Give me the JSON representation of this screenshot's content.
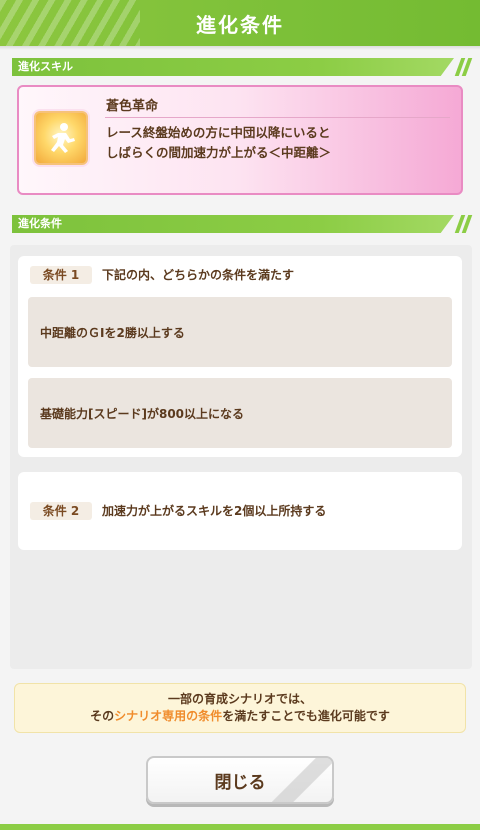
{
  "header": {
    "title": "進化条件"
  },
  "skill_section": {
    "label": "進化スキル"
  },
  "skill": {
    "icon": "running-figure-icon",
    "name": "蒼色革命",
    "description_line1": "レース終盤始めの方に中団以降にいると",
    "description_line2": "しばらくの間加速力が上がる＜中距離＞"
  },
  "condition_section": {
    "label": "進化条件"
  },
  "conditions": [
    {
      "tag": "条件 1",
      "text": "下記の内、どちらかの条件を満たす",
      "items": [
        "中距離のＧⅠを2勝以上する",
        "基礎能力[スピード]が800以上になる"
      ]
    },
    {
      "tag": "条件 2",
      "text": "加速力が上がるスキルを2個以上所持する"
    }
  ],
  "notice": {
    "line1": "一部の育成シナリオでは、",
    "line2_prefix": "その",
    "line2_highlight": "シナリオ専用の条件",
    "line2_suffix": "を満たすことでも進化可能です"
  },
  "buttons": {
    "close_label": "閉じる"
  },
  "colors": {
    "accent_green": "#8cc63f",
    "highlight_orange": "#f08c2c",
    "skill_pink": "#e98bc3"
  }
}
